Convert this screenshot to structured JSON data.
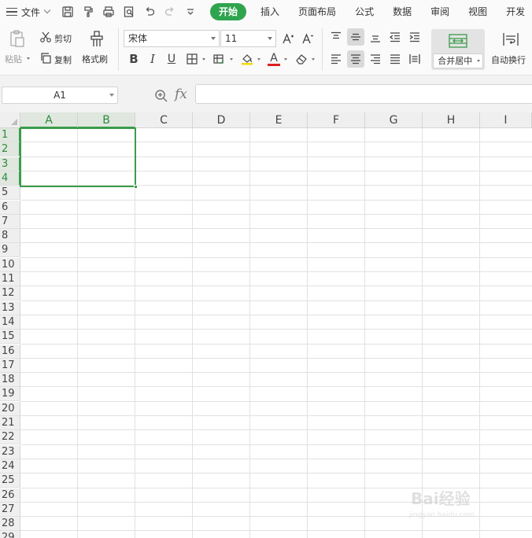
{
  "menu": {
    "file_label": "文件",
    "tabs": [
      "开始",
      "插入",
      "页面布局",
      "公式",
      "数据",
      "审阅",
      "视图",
      "开发"
    ],
    "active_tab": 0,
    "active_color": "#2fa44f"
  },
  "quick_access": {
    "icons": [
      "save-icon",
      "format-painter-quick-icon",
      "print-icon",
      "print-preview-icon",
      "undo-icon",
      "redo-icon",
      "customize-icon"
    ]
  },
  "ribbon": {
    "paste_label": "粘贴",
    "cut_label": "剪切",
    "copy_label": "复制",
    "format_painter_label": "格式刷",
    "font_name": "宋体",
    "font_size": "11",
    "bold_label": "B",
    "italic_label": "I",
    "underline_label": "U",
    "font_color_label": "A",
    "merge_center_label": "合并居中",
    "wrap_text_label": "自动换行"
  },
  "formula_bar": {
    "name_box": "A1",
    "fx_label": "fx",
    "formula": ""
  },
  "grid": {
    "columns": [
      "A",
      "B",
      "C",
      "D",
      "E",
      "F",
      "G",
      "H",
      "I"
    ],
    "rows": [
      "1",
      "2",
      "3",
      "4",
      "5",
      "6",
      "7",
      "8",
      "9",
      "10",
      "11",
      "12",
      "13",
      "14",
      "15",
      "16",
      "17",
      "18",
      "19",
      "20",
      "21",
      "22",
      "23",
      "24",
      "25",
      "26",
      "27",
      "28",
      "29"
    ],
    "selected_columns": [
      "A",
      "B"
    ],
    "selected_rows": [
      "1",
      "2",
      "3",
      "4"
    ],
    "selection_color": "#3a9c4a"
  },
  "watermark": {
    "text": "Bai经验",
    "sub": "jingyan.baidu.com"
  }
}
